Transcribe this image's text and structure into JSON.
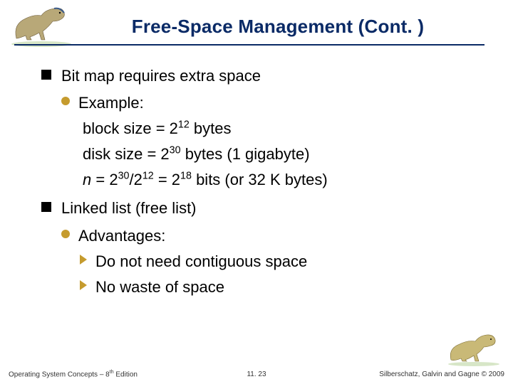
{
  "title": "Free-Space Management (Cont. )",
  "bullets": {
    "b1": "Bit map requires extra space",
    "b1_1": "Example:",
    "b1_1_a_pre": "block size = 2",
    "b1_1_a_exp": "12",
    "b1_1_a_post": " bytes",
    "b1_1_b_pre": "disk size = 2",
    "b1_1_b_exp": "30",
    "b1_1_b_post": " bytes (1 gigabyte)",
    "b1_1_c_n": "n",
    "b1_1_c_eq1": " = 2",
    "b1_1_c_exp1": "30",
    "b1_1_c_slash": "/2",
    "b1_1_c_exp2": "12",
    "b1_1_c_eq2": " = 2",
    "b1_1_c_exp3": "18",
    "b1_1_c_post": " bits (or 32 K bytes)",
    "b2": "Linked list (free list)",
    "b2_1": "Advantages:",
    "b2_1_a": "Do not need contiguous space",
    "b2_1_b": "No waste of space"
  },
  "footer": {
    "left_pre": "Operating System Concepts – 8",
    "left_th": "th",
    "left_post": " Edition",
    "center": "11. 23",
    "right": "Silberschatz, Galvin and Gagne © 2009"
  },
  "icons": {
    "dino_top": "dinosaur-icon",
    "dino_bot": "dinosaur-icon"
  }
}
